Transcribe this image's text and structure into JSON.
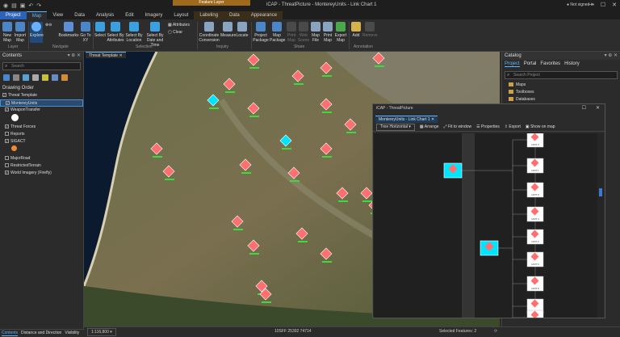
{
  "titlebar": {
    "context_tab": "Feature Layer",
    "title": "iCAP - ThreatPicture - MontereyUnits - Link Chart 1",
    "signin": "Not signed in"
  },
  "tabs": [
    "Project",
    "Map",
    "View",
    "Data",
    "Analysis",
    "Edit",
    "Imagery",
    "Layout",
    "Labeling",
    "Data",
    "Appearance"
  ],
  "ribbon": {
    "buttons": {
      "new_map": "New Map",
      "import_map": "Import Map",
      "explore": "Explore",
      "bookmarks": "Bookmarks",
      "go_to_xy": "Go To XY",
      "select": "Select",
      "select_by_attributes": "Select By Attributes",
      "select_by_location": "Select By Location",
      "select_by_date": "Select By Date and Time",
      "attributes": "Attributes",
      "clear": "Clear",
      "coordinate_conversion": "Coordinate Conversion",
      "measure": "Measure",
      "locate": "Locate",
      "project_package": "Project Package",
      "map_package": "Map Package",
      "print_map": "Print Map",
      "web_scene": "Web Scene",
      "map_file": "Map File",
      "print": "Print Map",
      "export_map": "Export Map",
      "add": "Add",
      "remove": "Remove"
    },
    "groups": {
      "layer": "Layer",
      "navigate": "Navigate",
      "selection": "Selection",
      "inquiry": "Inquiry",
      "share": "Share",
      "annotation": "Annotation"
    }
  },
  "contents": {
    "title": "Contents",
    "search_placeholder": "Search",
    "drawing_order": "Drawing Order",
    "items": [
      {
        "label": "Threat Template",
        "level": 0,
        "checked": true
      },
      {
        "label": "MontereyUnits",
        "level": 1,
        "checked": true,
        "selected": true
      },
      {
        "label": "WeaponTransfer",
        "level": 1,
        "checked": true
      },
      {
        "label": "Threat Forces",
        "level": 1,
        "checked": true
      },
      {
        "label": "Reports",
        "level": 1,
        "checked": false
      },
      {
        "label": "SIGACT",
        "level": 1,
        "checked": true
      },
      {
        "label": "MajorRoad",
        "level": 1,
        "checked": false
      },
      {
        "label": "RestrictedTerrain",
        "level": 1,
        "checked": false
      },
      {
        "label": "World Imagery (Firefly)",
        "level": 1,
        "checked": true
      }
    ],
    "bottom_tabs": [
      "Contents",
      "Distance and Direction",
      "Visibility"
    ]
  },
  "map": {
    "tab": "Threat Template",
    "scale": "1:116,800",
    "coordinates": "10SFF 25392 74714",
    "selected_features": "Selected Features: 2"
  },
  "catalog": {
    "title": "Catalog",
    "tabs": [
      "Project",
      "Portal",
      "Favorites",
      "History"
    ],
    "search_placeholder": "Search Project",
    "items": [
      "Maps",
      "Toolboxes",
      "Databases"
    ]
  },
  "linkchart": {
    "window_title": "iCAP - ThreatPicture",
    "tab": "MontereyUnits - Link Chart 1",
    "layout_dropdown": "Tree Horizontal",
    "arrange": "Arrange",
    "fit": "Fit to window",
    "properties": "Properties",
    "export": "Export",
    "show_on_map": "Show on map",
    "leaf_labels": [
      "UNIT 3",
      "UNIT 1",
      "UNIT 9",
      "UNIT 4",
      "UNIT 2",
      "UNIT 6",
      "UNIT 5",
      "UNIT 7",
      "UNIT 8"
    ]
  },
  "colors": {
    "accent": "#5fb6ff",
    "project_tab": "#2a63b8",
    "context_tab": "#a06a1c",
    "hostile": "#ff6f6f",
    "selected_node": "#00e5ff",
    "leaf_node": "#ffffff"
  }
}
